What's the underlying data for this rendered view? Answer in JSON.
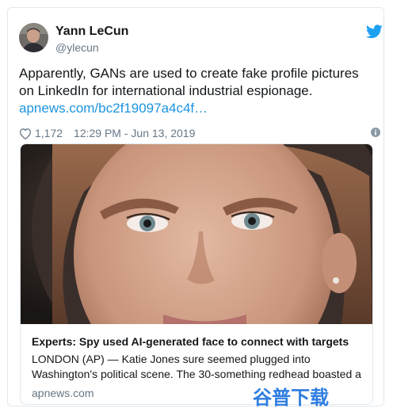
{
  "tweet": {
    "author_name": "Yann LeCun",
    "author_handle": "@ylecun",
    "text": "Apparently, GANs are used to create fake profile pictures on LinkedIn for international industrial espionage.",
    "link_text": "apnews.com/bc2f19097a4c4f…",
    "likes": "1,172",
    "timestamp": "12:29 PM - Jun 13, 2019"
  },
  "preview": {
    "title": "Experts: Spy used AI-generated face to connect with targets",
    "description": "LONDON (AP) — Katie Jones sure seemed plugged into Washington's political scene. The 30-something redhead boasted a",
    "domain": "apnews.com"
  },
  "watermark": {
    "text": "谷普下载"
  },
  "icons": {
    "logo": "twitter-bird-icon",
    "like": "heart-icon",
    "info": "info-icon"
  },
  "colors": {
    "twitter_blue": "#1da1f2",
    "link_blue": "#1b95e0",
    "muted_gray": "#657786",
    "watermark_blue": "#2f7de1"
  }
}
